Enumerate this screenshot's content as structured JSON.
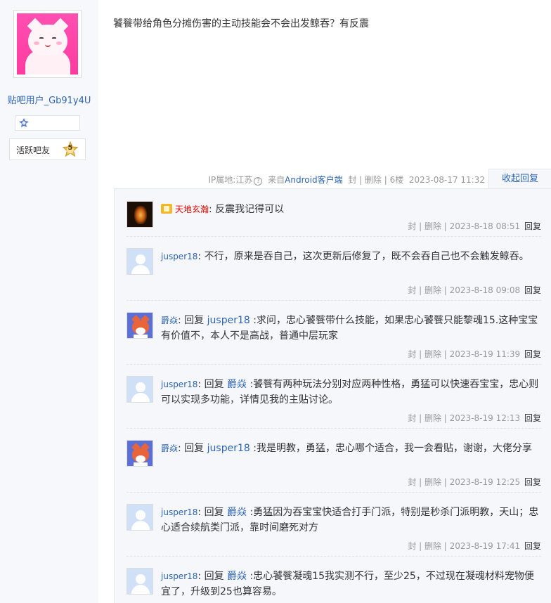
{
  "author": {
    "username": "贴吧用户_Gb91y4U",
    "level_title": "活跃吧友",
    "level": "5"
  },
  "post": {
    "content": "饕餮带给角色分摊伤害的主动技能会不会出发鲸吞？有反震",
    "ip_label": "IP属地:江苏",
    "source_prefix": "来自",
    "source_name": "Android客户端",
    "actions": "封 | 删除 |",
    "floor": "6楼",
    "time": "2023-08-17 11:32",
    "collapse_label": "收起回复"
  },
  "replies": [
    {
      "avatar": "fire-avatar",
      "user": "天地玄瀚",
      "reply_word": "",
      "target": "",
      "text": ": 反震我记得可以",
      "actions": "封 | 删除 |",
      "time": "2023-8-18 08:51",
      "reply_label": "回复"
    },
    {
      "avatar": "default-avatar",
      "user": "jusper18",
      "reply_word": "",
      "target": "",
      "text": ": 不行，原来是吞自己，这次更新后修复了，既不会吞自己也不会触发鲸吞。",
      "actions": "封 | 删除 |",
      "time": "2023-8-18 09:08",
      "reply_label": "回复"
    },
    {
      "avatar": "fox-avatar",
      "user": "爵焱",
      "reply_word": ": 回复 ",
      "target": "jusper18",
      "text": " :求问，忠心饕餮带什么技能，如果忠心饕餮只能黎魂15.这种宝宝有价值不，本人不是高战，普通中层玩家",
      "actions": "封 | 删除 |",
      "time": "2023-8-19 11:39",
      "reply_label": "回复"
    },
    {
      "avatar": "default-avatar",
      "user": "jusper18",
      "reply_word": ": 回复 ",
      "target": "爵焱",
      "text": " :饕餮有两种玩法分别对应两种性格，勇猛可以快速吞宝宝，忠心则可以实现多功能，详情见我的主贴讨论。",
      "actions": "封 | 删除 |",
      "time": "2023-8-19 12:13",
      "reply_label": "回复"
    },
    {
      "avatar": "fox-avatar",
      "user": "爵焱",
      "reply_word": ": 回复 ",
      "target": "jusper18",
      "text": " :我是明教，勇猛，忠心哪个适合，我一会看贴，谢谢，大佬分享",
      "actions": "封 | 删除 |",
      "time": "2023-8-19 12:25",
      "reply_label": "回复"
    },
    {
      "avatar": "default-avatar",
      "user": "jusper18",
      "reply_word": ": 回复 ",
      "target": "爵焱",
      "text": " :勇猛因为吞宝宝快适合打手门派，特别是秒杀门派明教，天山；忠心适合续航类门派，靠时间磨死对方",
      "actions": "封 | 删除 |",
      "time": "2023-8-19 17:41",
      "reply_label": "回复"
    },
    {
      "avatar": "default-avatar",
      "user": "jusper18",
      "reply_word": ": 回复 ",
      "target": "爵焱",
      "text": " :忠心饕餮凝魂15我实测不行，至少25，不过现在凝魂材料宠物便宜了，升级到25也算容易。",
      "actions": "",
      "time": "",
      "reply_label": ""
    }
  ]
}
